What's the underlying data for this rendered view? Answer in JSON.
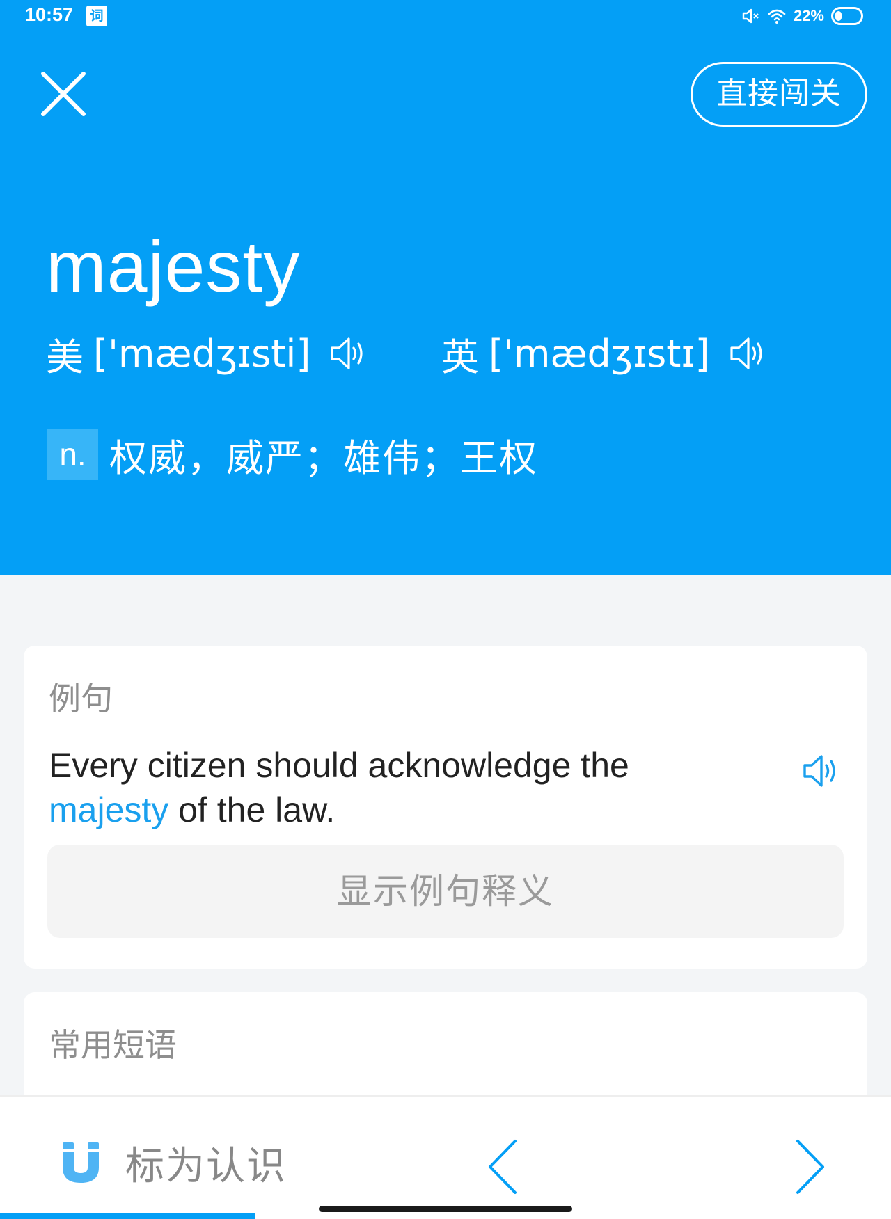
{
  "status_bar": {
    "time": "10:57",
    "app_icon_glyph": "词",
    "battery": "22%",
    "icons": [
      "mute-icon",
      "wifi-icon",
      "battery-icon"
    ]
  },
  "header": {
    "close_icon": "close-icon",
    "pass_button": "直接闯关"
  },
  "word": {
    "text": "majesty",
    "us_region": "美",
    "us_phonetic": "['mædʒɪsti]",
    "uk_region": "英",
    "uk_phonetic": "['mædʒɪstɪ]",
    "pos": "n.",
    "definition": "权威，威严；雄伟；王权"
  },
  "examples": {
    "title": "例句",
    "sentence_before": "Every citizen should acknowledge the ",
    "sentence_highlight": "majesty",
    "sentence_after": " of the law.",
    "show_translation_button": "显示例句释义"
  },
  "phrases": {
    "title": "常用短语"
  },
  "bottom_bar": {
    "mark_known_label": "标为认识",
    "prev_icon": "chevron-left-icon",
    "next_icon": "chevron-right-icon"
  },
  "colors": {
    "primary_blue": "#049ff6",
    "highlight_blue": "#1aa0ee",
    "background": "#f3f5f7"
  }
}
